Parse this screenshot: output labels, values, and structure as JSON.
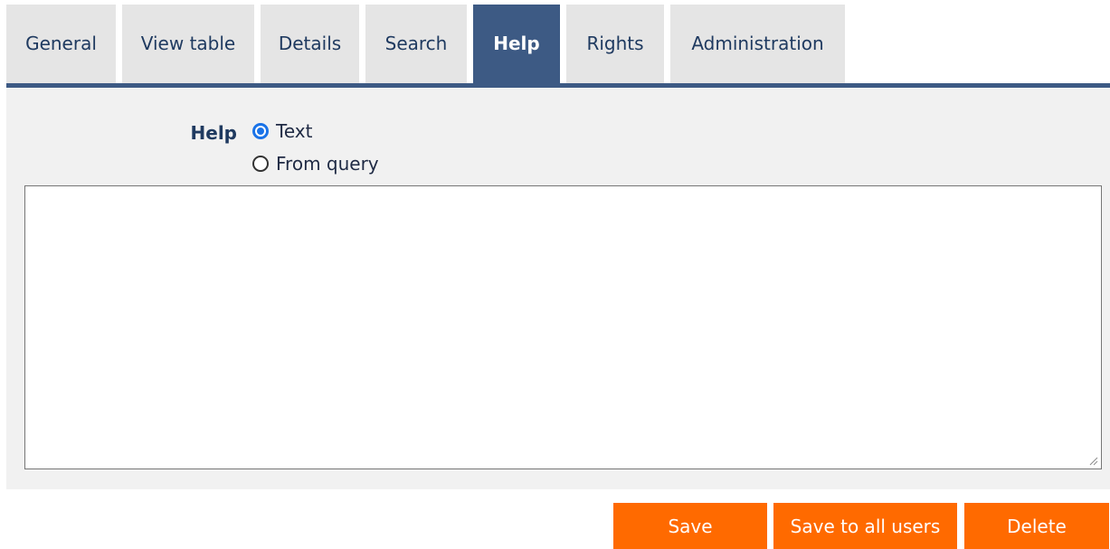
{
  "tabs": [
    {
      "label": "General",
      "active": false
    },
    {
      "label": "View table",
      "active": false
    },
    {
      "label": "Details",
      "active": false
    },
    {
      "label": "Search",
      "active": false
    },
    {
      "label": "Help",
      "active": true
    },
    {
      "label": "Rights",
      "active": false
    },
    {
      "label": "Administration",
      "active": false
    }
  ],
  "help_form": {
    "label": "Help",
    "options": [
      {
        "label": "Text",
        "checked": true
      },
      {
        "label": "From query",
        "checked": false
      }
    ],
    "textarea_value": ""
  },
  "buttons": {
    "save": "Save",
    "save_all": "Save to all users",
    "delete": "Delete"
  },
  "colors": {
    "accent": "#3d5a84",
    "tab_bg": "#e5e5e5",
    "panel_bg": "#f1f1f1",
    "button": "#ff6a00",
    "radio_checked": "#1a73e8"
  }
}
